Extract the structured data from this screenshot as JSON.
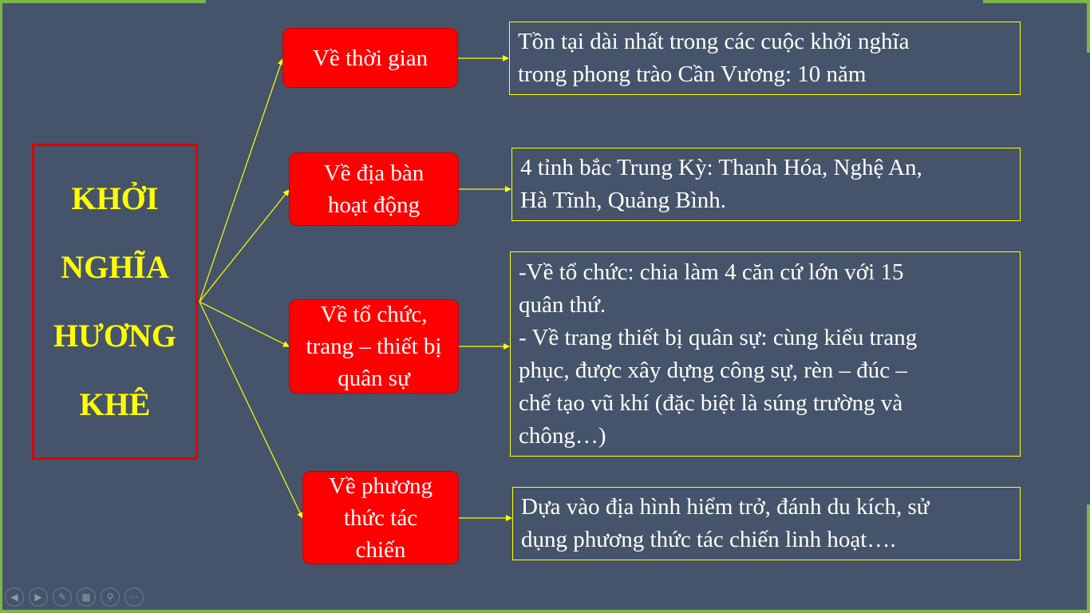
{
  "main_title": [
    "KHỞI",
    "NGHĨA",
    "HƯƠNG",
    "KHÊ"
  ],
  "categories": [
    {
      "label": "Về thời gian"
    },
    {
      "label": "Về địa bàn hoạt động"
    },
    {
      "label": "Về tổ chức, trang – thiết bị quân sự"
    },
    {
      "label": "Về phương thức tác chiến"
    }
  ],
  "descriptions": [
    {
      "lines": [
        "Tồn tại dài nhất trong các cuộc khởi nghĩa",
        "trong phong trào Cần Vương: 10 năm"
      ]
    },
    {
      "lines": [
        "4 tỉnh bắc Trung Kỳ: Thanh Hóa, Nghệ An,",
        "Hà Tĩnh, Quảng Bình."
      ]
    },
    {
      "lines": [
        "-Về tổ chức: chia làm 4 căn cứ lớn với 15",
        "quân thứ.",
        "- Về trang thiết bị quân sự: cùng kiểu trang",
        "phục, được xây dựng công sự, rèn – đúc –",
        "chế tạo vũ khí (đặc biệt là súng trường và",
        "chông…)"
      ]
    },
    {
      "lines": [
        "Dựa vào địa hình hiểm trở, đánh du kích, sử",
        "dụng phương thức tác chiến linh hoạt…."
      ]
    }
  ],
  "colors": {
    "background": "#45546a",
    "title_text": "#ffff00",
    "title_border": "#e00000",
    "category_fill": "#ff0000",
    "description_border": "#ffff00",
    "connector": "#ffff00"
  },
  "toolbar_icons": [
    "previous-icon",
    "next-icon",
    "pen-icon",
    "slides-icon",
    "zoom-icon",
    "more-icon"
  ]
}
